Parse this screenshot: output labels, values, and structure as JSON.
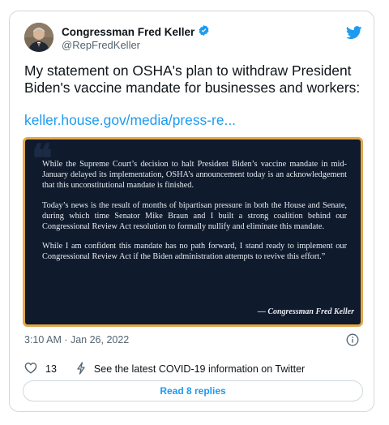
{
  "author": {
    "name": "Congressman Fred Keller",
    "handle": "@RepFredKeller",
    "verified": true
  },
  "tweet": {
    "text": "My statement on OSHA's plan to withdraw President Biden's vaccine mandate for businesses and workers:",
    "link": "keller.house.gov/media/press-re..."
  },
  "statement_image": {
    "quote_glyph": "❝",
    "paragraphs": [
      "While the Supreme Court’s decision to halt President Biden’s vaccine mandate in mid-January delayed its implementation, OSHA’s announcement today is an acknowledgement that this unconstitutional mandate is finished.",
      "Today’s news is the result of months of bipartisan pressure in both the House and Senate, during which time Senator Mike Braun and I built a strong coalition behind our Congressional Review Act resolution to formally nullify and eliminate this mandate.",
      "While I am confident this mandate has no path forward, I stand ready to implement our Congressional Review Act if the Biden administration attempts to revive this effort.”"
    ],
    "signature": "— Congressman Fred Keller"
  },
  "meta": {
    "timestamp": "3:10 AM · Jan 26, 2022"
  },
  "actions": {
    "like_count": "13",
    "covid_text": "See the latest COVID-19 information on Twitter"
  },
  "replies_button": "Read 8 replies",
  "colors": {
    "twitter_blue": "#1d9bf0",
    "image_background": "#0f1a2c",
    "image_border": "#e2a84b"
  },
  "icons": [
    "verified-badge-icon",
    "twitter-bird-icon",
    "info-icon",
    "heart-icon",
    "lightning-icon"
  ]
}
